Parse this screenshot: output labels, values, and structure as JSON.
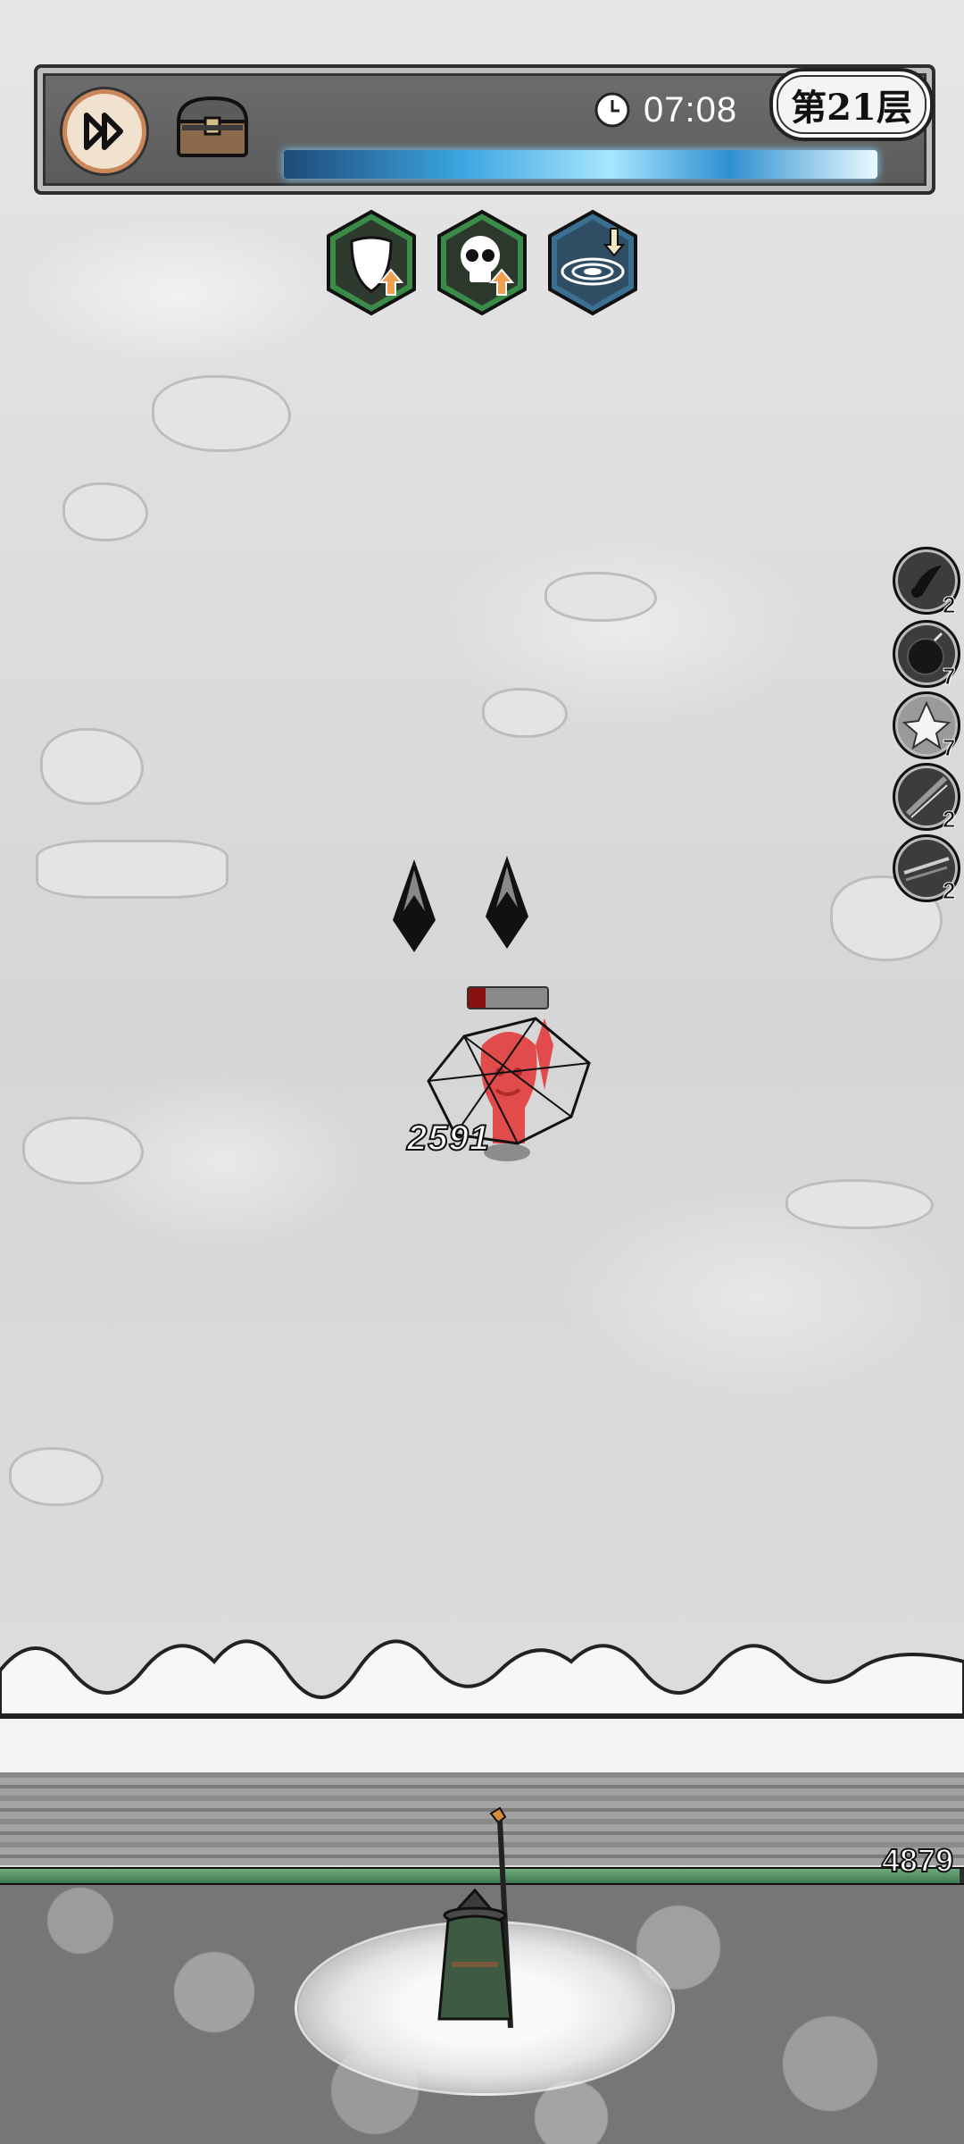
{
  "hud": {
    "timer": "07:08",
    "floor_label": "第21层",
    "speed_button_icon": "fast-forward-icon",
    "chest_button_icon": "treasure-chest-icon",
    "clock_icon": "clock-icon"
  },
  "buffs": [
    {
      "icon": "shield-upgrade-icon",
      "border": "#2f8a3c"
    },
    {
      "icon": "skull-upgrade-icon",
      "border": "#2f8a3c"
    },
    {
      "icon": "whirlpool-down-icon",
      "border": "#2f6a8f"
    }
  ],
  "skills": [
    {
      "icon": "dark-orb-skill-icon",
      "count": "2"
    },
    {
      "icon": "bomb-skill-icon",
      "count": "7"
    },
    {
      "icon": "crystal-skill-icon",
      "count": "7"
    },
    {
      "icon": "dash-skill-icon",
      "count": "2"
    },
    {
      "icon": "slash-skill-icon",
      "count": "2"
    }
  ],
  "enemy": {
    "damage_number": "2591",
    "health_fraction": 0.22
  },
  "player": {
    "wall_hp": "4879",
    "health_fraction": 0.995
  },
  "colors": {
    "enemy_red": "#e24b4b",
    "hp_green": "#4f8a5e",
    "speed_button_border": "#c9875a"
  }
}
